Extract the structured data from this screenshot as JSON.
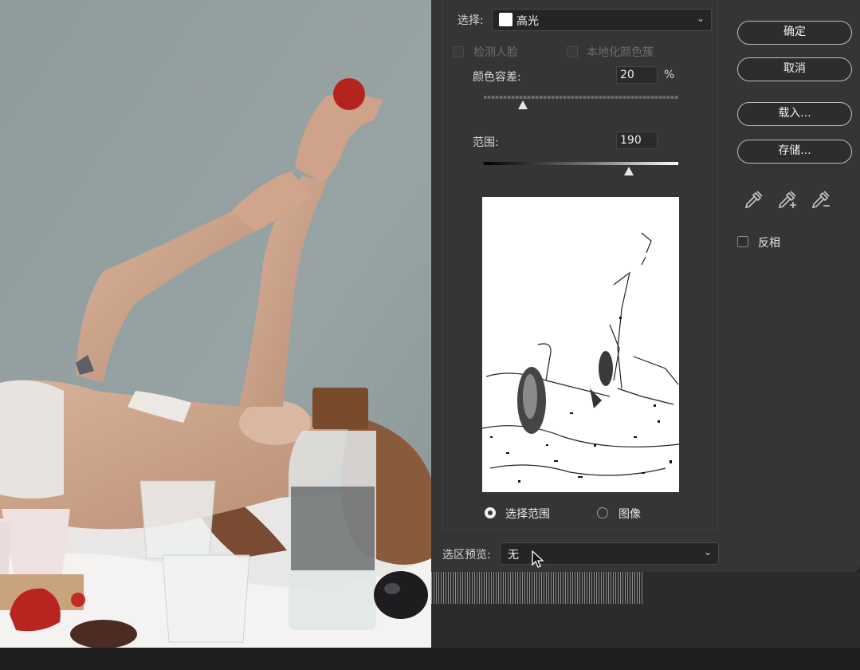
{
  "dialog": {
    "select_label": "选择:",
    "select_value": "高光",
    "detect_faces_label": "检测人脸",
    "localized_clusters_label": "本地化颜色簇",
    "fuzziness_label": "颜色容差:",
    "fuzziness_value": "20",
    "fuzziness_unit": "%",
    "fuzziness_level": 0.2,
    "range_label": "范围:",
    "range_value": "190",
    "range_level": 0.745,
    "radio_selection_label": "选择范围",
    "radio_image_label": "图像",
    "radio_selected": "selection",
    "preview_label": "选区预览:",
    "preview_value": "无",
    "buttons": {
      "ok": "确定",
      "cancel": "取消",
      "load": "载入...",
      "save": "存储..."
    },
    "eyedroppers": [
      "eyedropper-icon",
      "eyedropper-add-icon",
      "eyedropper-subtract-icon"
    ],
    "invert_label": "反相",
    "invert_checked": false
  },
  "colors": {
    "dialog_bg": "#353535",
    "button_border": "#bdbdbd"
  }
}
